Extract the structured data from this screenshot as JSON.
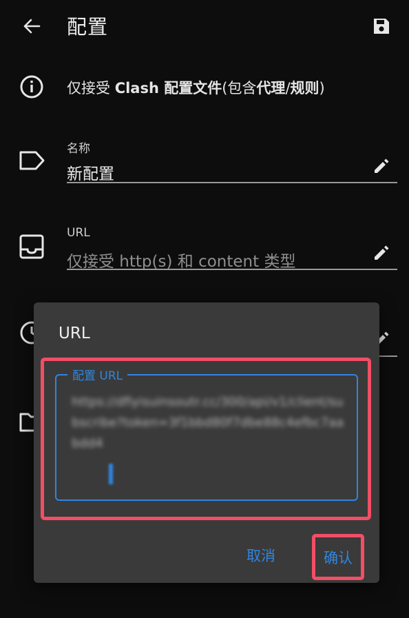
{
  "header": {
    "title": "配置",
    "back_icon": "arrow-left-icon",
    "save_icon": "save-icon"
  },
  "info": {
    "prefix": "仅接受 ",
    "bold_text": "Clash 配置文件",
    "mid": "(包含",
    "bold_text2": "代理",
    "slash": "/",
    "bold_text3": "规则",
    "suffix": ")"
  },
  "form": {
    "name": {
      "label": "名称",
      "value": "新配置",
      "icon": "tag-icon"
    },
    "url": {
      "label": "URL",
      "placeholder": "仅接受 http(s) 和 content 类型",
      "icon": "inbox-icon"
    }
  },
  "dialog": {
    "title": "URL",
    "field_label": "配置 URL",
    "field_value": "https://dfiyisuinsoutr.cc/300/api/v1/client/subscribe?token=3f1bbd80f7dbe88c4efbc7aabdd4",
    "cancel_label": "取消",
    "confirm_label": "确认"
  },
  "colors": {
    "background": "#0d0d0d",
    "dialog": "#3a3a3a",
    "accent": "#2f86e0",
    "highlight": "#f24e65"
  }
}
